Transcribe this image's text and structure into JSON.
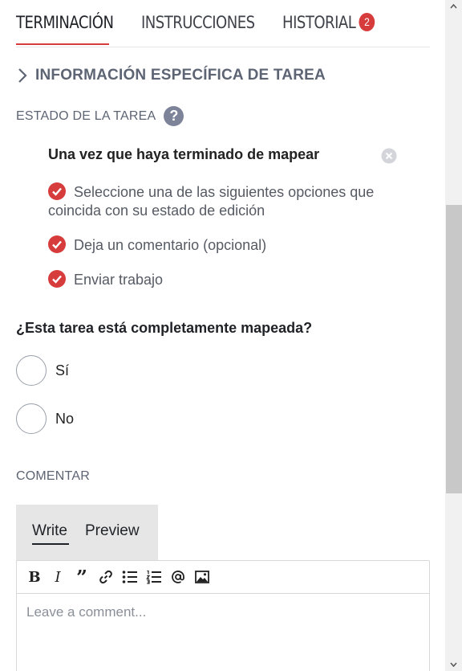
{
  "tabs": [
    {
      "label": "TERMINACIÓN"
    },
    {
      "label": "INSTRUCCIONES"
    },
    {
      "label": "HISTORIAL",
      "badge": "2"
    }
  ],
  "task_info": {
    "label": "INFORMACIÓN ESPECÍFICA DE TAREA"
  },
  "estado": {
    "label": "ESTADO DE LA TAREA",
    "help": "?"
  },
  "checklist": {
    "title": "Una vez que haya terminado de mapear",
    "items": [
      "Seleccione una de las siguientes opciones que coincida con su estado de edición",
      "Deja un comentario (opcional)",
      "Enviar trabajo"
    ]
  },
  "question": "¿Esta tarea está completamente mapeada?",
  "options": [
    "Sí",
    "No"
  ],
  "comment": {
    "label": "COMENTAR",
    "write_tab": "Write",
    "preview_tab": "Preview",
    "placeholder": "Leave a comment...",
    "toolbar_icons": [
      "bold-icon",
      "italic-icon",
      "quote-icon",
      "link-icon",
      "bullet-list-icon",
      "numbered-list-icon",
      "mention-icon",
      "image-icon"
    ]
  },
  "colors": {
    "accent": "#d73c3c",
    "muted": "#5d6473"
  }
}
